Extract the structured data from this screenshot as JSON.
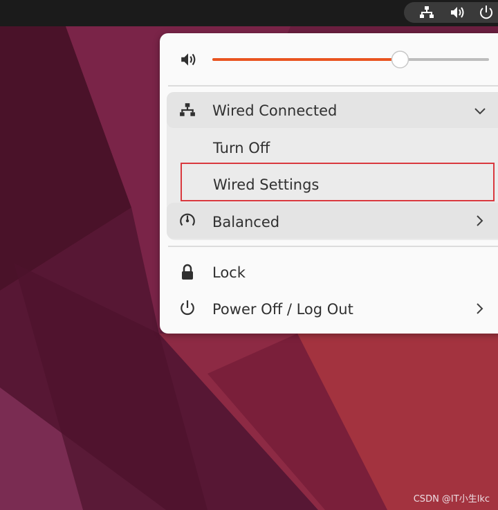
{
  "colors": {
    "accent": "#e95420",
    "highlight_border": "#d9383e",
    "menu_bg": "#fafafa",
    "desktop": "#6a1e3e"
  },
  "tray": {
    "icons": [
      "network-wired-icon",
      "volume-icon",
      "power-icon"
    ]
  },
  "volume": {
    "level": 0.69
  },
  "network": {
    "label": "Wired Connected",
    "icon": "network-wired-icon",
    "expanded": true,
    "submenu": [
      {
        "label": "Turn Off"
      },
      {
        "label": "Wired Settings"
      }
    ]
  },
  "power_mode": {
    "label": "Balanced",
    "icon": "gauge-icon"
  },
  "lock": {
    "label": "Lock",
    "icon": "lock-icon"
  },
  "power": {
    "label": "Power Off / Log Out",
    "icon": "power-icon"
  },
  "watermark": "CSDN @IT小生lkc"
}
